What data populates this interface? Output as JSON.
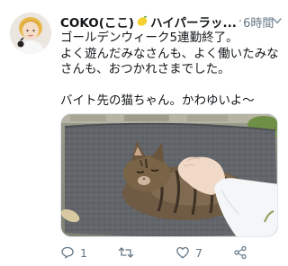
{
  "tweet": {
    "display_name": "COKO(ここ)",
    "display_name_after_icon": "ハイパーラッ...",
    "separator": "·",
    "timestamp": "6時間",
    "name_icon": "lemon-emoji",
    "lines": [
      "ゴールデンウィーク5連勤終了。",
      "よく遊んだみなさんも、よく働いたみな",
      "さんも、おつかれさまでした。",
      "",
      "バイト先の猫ちゃん。かわゆいよ〜"
    ],
    "photo_subject": "tabby cat being petted on a grey mat"
  },
  "actions": {
    "reply_count": "1",
    "retweet_count": "",
    "like_count": "7",
    "icons": [
      "reply-icon",
      "retweet-icon",
      "like-icon",
      "share-icon"
    ]
  },
  "colors": {
    "text": "#14171a",
    "secondary": "#657786",
    "border": "#e1e8ed"
  }
}
